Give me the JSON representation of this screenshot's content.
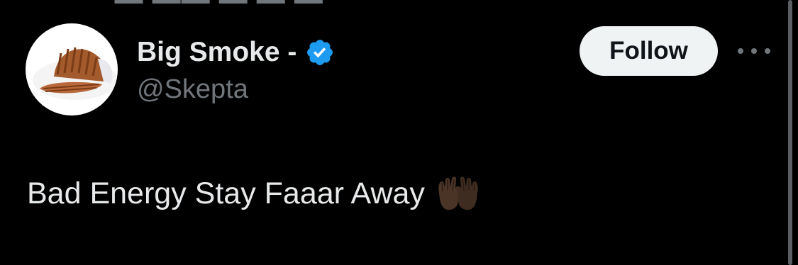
{
  "tweet": {
    "author": {
      "display_name": "Big Smoke -",
      "handle": "@Skepta",
      "verified": true
    },
    "follow_label": "Follow",
    "text": "Bad Energy Stay Faaar Away",
    "emoji": "raised-palms-dark-skin"
  },
  "colors": {
    "background": "#000000",
    "primary_text": "#e7e9ea",
    "secondary_text": "#71767b",
    "verified_blue": "#1d9bf0",
    "follow_button_bg": "#eff3f4",
    "follow_button_text": "#0f1419"
  },
  "icons": {
    "avatar": "brown-corduroy-cap",
    "verified": "verified-badge-icon",
    "more": "more-options-icon",
    "emoji": "raised-hands-icon"
  }
}
